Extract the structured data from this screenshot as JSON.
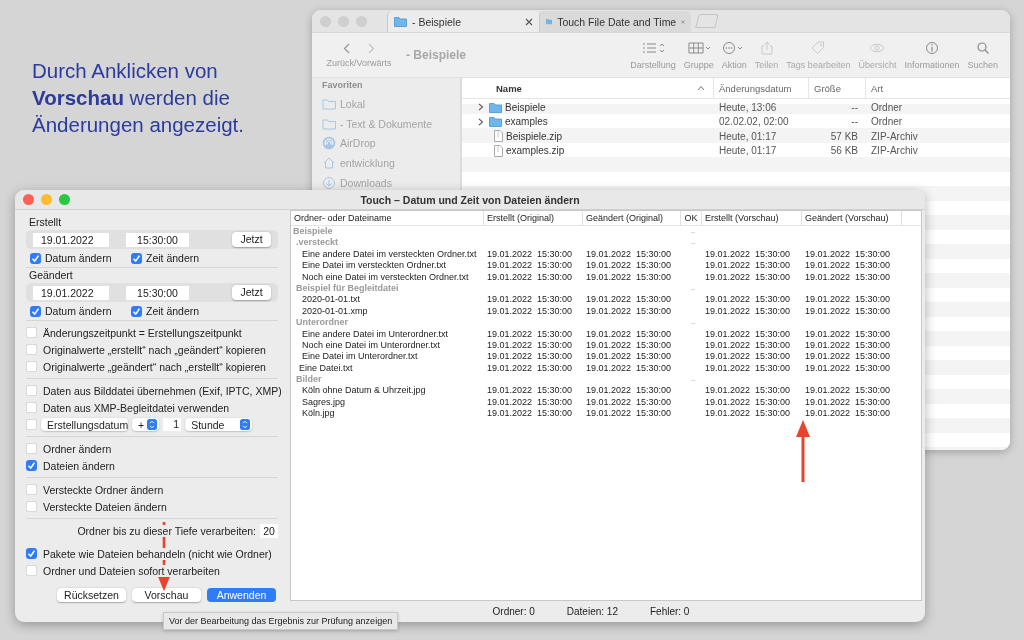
{
  "caption": "Durch Anklicken von **Vorschau** werden die Änderungen angezeigt.",
  "finder": {
    "tabs": [
      {
        "label": "- Beispiele",
        "selected": true
      },
      {
        "label": "Touch File Date and Time",
        "selected": false
      }
    ],
    "toolbar": {
      "nav_label": "Zurück/Vorwärts",
      "title": "- Beispiele",
      "tools": [
        {
          "label": "Darstellung",
          "disabled": false
        },
        {
          "label": "Gruppe",
          "disabled": false
        },
        {
          "label": "Aktion",
          "disabled": false
        },
        {
          "label": "Teilen",
          "disabled": true
        },
        {
          "label": "Tags bearbeiten",
          "disabled": true
        },
        {
          "label": "Übersicht",
          "disabled": true
        },
        {
          "label": "Informationen",
          "disabled": false
        },
        {
          "label": "Suchen",
          "disabled": false
        }
      ]
    },
    "sidebar": {
      "heading": "Favoriten",
      "items": [
        "Lokal",
        "- Text & Dokumente",
        "AirDrop",
        "entwicklung",
        "Downloads"
      ]
    },
    "columns": [
      {
        "label": "Name",
        "sorted": true
      },
      {
        "label": "Änderungsdatum",
        "sorted": false
      },
      {
        "label": "Größe",
        "sorted": false
      },
      {
        "label": "Art",
        "sorted": false
      }
    ],
    "rows": [
      {
        "name": "Beispiele",
        "kind": "folder",
        "date": "Heute, 13:06",
        "size": "--",
        "type": "Ordner"
      },
      {
        "name": "examples",
        "kind": "folder",
        "date": "02.02.02, 02:00",
        "size": "--",
        "type": "Ordner"
      },
      {
        "name": "Beispiele.zip",
        "kind": "file",
        "date": "Heute, 01:17",
        "size": "57 KB",
        "type": "ZIP-Archiv"
      },
      {
        "name": "examples.zip",
        "kind": "file",
        "date": "Heute, 01:17",
        "size": "56 KB",
        "type": "ZIP-Archiv"
      }
    ]
  },
  "touch": {
    "title": "Touch – Datum und Zeit von Dateien ändern",
    "sections": [
      {
        "label": "Erstellt",
        "date": "19.01.2022",
        "time": "15:30:00",
        "button": "Jetzt",
        "checks": [
          {
            "label": "Datum ändern",
            "checked": true
          },
          {
            "label": "Zeit ändern",
            "checked": true
          }
        ]
      },
      {
        "label": "Geändert",
        "date": "19.01.2022",
        "time": "15:30:00",
        "button": "Jetzt",
        "checks": [
          {
            "label": "Datum ändern",
            "checked": true
          },
          {
            "label": "Zeit ändern",
            "checked": true
          }
        ]
      }
    ],
    "option_groups": [
      [
        {
          "kind": "checkbox",
          "label": "Änderungszeitpunkt = Erstellungszeitpunkt",
          "checked": false
        },
        {
          "kind": "checkbox",
          "label": "Originalwerte „erstellt“ nach „geändert“ kopieren",
          "checked": false
        },
        {
          "kind": "checkbox",
          "label": "Originalwerte „geändert“ nach „erstellt“ kopieren",
          "checked": false
        }
      ],
      [
        {
          "kind": "checkbox",
          "label": "Daten aus Bilddatei übernehmen (Exif, IPTC, XMP)",
          "checked": false
        },
        {
          "kind": "checkbox",
          "label": "Daten aus XMP-Begleitdatei verwenden",
          "checked": false
        },
        {
          "kind": "offset",
          "checked": false,
          "field": "Erstellungsdatum",
          "sign": "+",
          "amount": "1",
          "unit": "Stunde"
        }
      ],
      [
        {
          "kind": "checkbox",
          "label": "Ordner ändern",
          "checked": false
        },
        {
          "kind": "checkbox",
          "label": "Dateien ändern",
          "checked": true
        }
      ],
      [
        {
          "kind": "checkbox",
          "label": "Versteckte Ordner ändern",
          "checked": false
        },
        {
          "kind": "checkbox",
          "label": "Versteckte Dateien ändern",
          "checked": false
        }
      ],
      [
        {
          "kind": "depth",
          "label": "Ordner bis zu dieser Tiefe verarbeiten:",
          "value": "20"
        },
        {
          "kind": "checkbox",
          "label": "Pakete wie Dateien behandeln (nicht wie Ordner)",
          "checked": true
        },
        {
          "kind": "checkbox",
          "label": "Ordner und Dateien sofort verarbeiten",
          "checked": false
        }
      ]
    ],
    "buttons": [
      {
        "label": "Rücksetzen",
        "kind": "normal"
      },
      {
        "label": "Vorschau",
        "kind": "normal"
      },
      {
        "label": "Anwenden",
        "kind": "primary"
      }
    ],
    "tooltip": "Vor der Bearbeitung das Ergebnis zur Prüfung anzeigen",
    "table": {
      "columns": [
        "Ordner- oder Dateiname",
        "Erstellt (Original)",
        "Geändert (Original)",
        "OK",
        "Erstellt (Vorschau)",
        "Geändert (Vorschau)"
      ],
      "rows": [
        {
          "name": "Beispiele",
          "kind": "folder",
          "ok": "–",
          "children": [
            {
              "name": ".versteckt",
              "kind": "folder",
              "ok": "–",
              "children": [
                {
                  "name": "Eine andere Datei im versteckten Ordner.txt",
                  "kind": "file",
                  "created": "19.01.2022  15:30:00",
                  "modified": "19.01.2022  15:30:00",
                  "created_preview": "19.01.2022  15:30:00",
                  "modified_preview": "19.01.2022  15:30:00"
                },
                {
                  "name": "Eine Datei im versteckten Ordner.txt",
                  "kind": "file",
                  "created": "19.01.2022  15:30:00",
                  "modified": "19.01.2022  15:30:00",
                  "created_preview": "19.01.2022  15:30:00",
                  "modified_preview": "19.01.2022  15:30:00"
                },
                {
                  "name": "Noch eine Datei im versteckten Ordner.txt",
                  "kind": "file",
                  "created": "19.01.2022  15:30:00",
                  "modified": "19.01.2022  15:30:00",
                  "created_preview": "19.01.2022  15:30:00",
                  "modified_preview": "19.01.2022  15:30:00"
                }
              ]
            },
            {
              "name": "Beispiel für Begleitdatei",
              "kind": "folder",
              "ok": "–",
              "children": [
                {
                  "name": "2020-01-01.txt",
                  "kind": "file",
                  "created": "19.01.2022  15:30:00",
                  "modified": "19.01.2022  15:30:00",
                  "created_preview": "19.01.2022  15:30:00",
                  "modified_preview": "19.01.2022  15:30:00"
                },
                {
                  "name": "2020-01-01.xmp",
                  "kind": "file",
                  "created": "19.01.2022  15:30:00",
                  "modified": "19.01.2022  15:30:00",
                  "created_preview": "19.01.2022  15:30:00",
                  "modified_preview": "19.01.2022  15:30:00"
                }
              ]
            },
            {
              "name": "Unterordner",
              "kind": "folder",
              "ok": "–",
              "children": [
                {
                  "name": "Eine andere Datei im Unterordner.txt",
                  "kind": "file",
                  "created": "19.01.2022  15:30:00",
                  "modified": "19.01.2022  15:30:00",
                  "created_preview": "19.01.2022  15:30:00",
                  "modified_preview": "19.01.2022  15:30:00"
                },
                {
                  "name": "Noch eine Datei im Unterordner.txt",
                  "kind": "file",
                  "created": "19.01.2022  15:30:00",
                  "modified": "19.01.2022  15:30:00",
                  "created_preview": "19.01.2022  15:30:00",
                  "modified_preview": "19.01.2022  15:30:00"
                },
                {
                  "name": "Eine Datei im Unterordner.txt",
                  "kind": "file",
                  "created": "19.01.2022  15:30:00",
                  "modified": "19.01.2022  15:30:00",
                  "created_preview": "19.01.2022  15:30:00",
                  "modified_preview": "19.01.2022  15:30:00"
                }
              ]
            },
            {
              "name": "Eine Datei.txt",
              "kind": "file",
              "created": "19.01.2022  15:30:00",
              "modified": "19.01.2022  15:30:00",
              "created_preview": "19.01.2022  15:30:00",
              "modified_preview": "19.01.2022  15:30:00"
            },
            {
              "name": "Bilder",
              "kind": "folder",
              "ok": "–",
              "children": [
                {
                  "name": "Köln ohne Datum & Uhrzeit.jpg",
                  "kind": "file",
                  "created": "19.01.2022  15:30:00",
                  "modified": "19.01.2022  15:30:00",
                  "created_preview": "19.01.2022  15:30:00",
                  "modified_preview": "19.01.2022  15:30:00"
                },
                {
                  "name": "Sagres.jpg",
                  "kind": "file",
                  "created": "19.01.2022  15:30:00",
                  "modified": "19.01.2022  15:30:00",
                  "created_preview": "19.01.2022  15:30:00",
                  "modified_preview": "19.01.2022  15:30:00"
                },
                {
                  "name": "Köln.jpg",
                  "kind": "file",
                  "created": "19.01.2022  15:30:00",
                  "modified": "19.01.2022  15:30:00",
                  "created_preview": "19.01.2022  15:30:00",
                  "modified_preview": "19.01.2022  15:30:00"
                }
              ]
            }
          ]
        }
      ]
    },
    "status": [
      "Ordner: 0",
      "Dateien: 12",
      "Fehler: 0"
    ]
  }
}
